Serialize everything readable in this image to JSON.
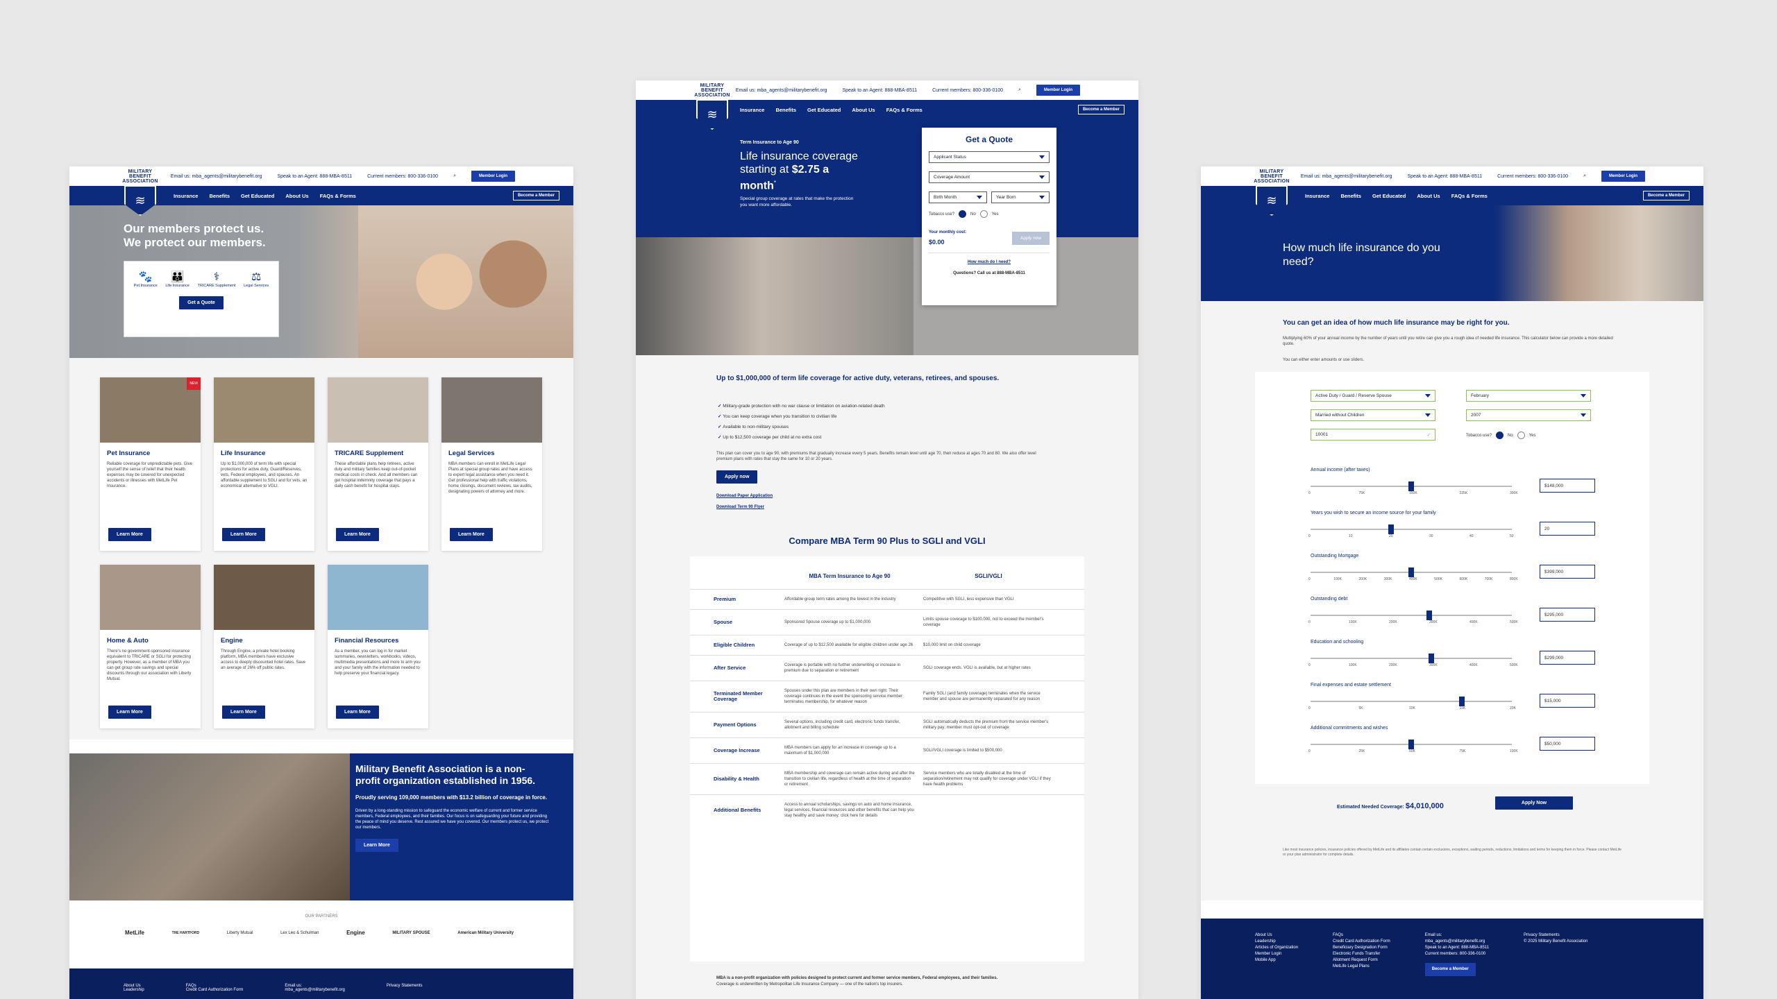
{
  "header": {
    "logo_text": [
      "MILITARY",
      "BENEFIT",
      "ASSOCIATION"
    ],
    "email": "Email us: mba_agents@militarybenefit.org",
    "agent": "Speak to an Agent: 888-MBA-8511",
    "members": "Current members: 800-336-0100",
    "login": "Member Login",
    "nav": [
      "Insurance",
      "Benefits",
      "Get Educated",
      "About Us",
      "FAQs & Forms"
    ],
    "become": "Become a Member"
  },
  "home": {
    "hero_title_1": "Our members protect us.",
    "hero_title_2": "We protect our members.",
    "quote_icons": [
      "Pet Insurance",
      "Life Insurance",
      "TRICARE Supplement",
      "Legal Services"
    ],
    "quote_btn": "Get a Quote",
    "cards": [
      {
        "title": "Pet Insurance",
        "text": "Reliable coverage for unpredictable pets. Give yourself the sense of relief that their health expenses may be covered for unexpected accidents or illnesses with MetLife Pet Insurance.",
        "btn": "Learn More",
        "badge": "NEW"
      },
      {
        "title": "Life Insurance",
        "text": "Up to $1,000,000 of term life with special protections for active duty, Guard/Reserves, vets, Federal employees, and spouses. An affordable supplement to SGLI and for vets, an economical alternative to VGLI.",
        "btn": "Learn More"
      },
      {
        "title": "TRICARE Supplement",
        "text": "These affordable plans help retirees, active duty and military families keep out-of-pocket medical costs in check. And all members can get hospital indemnity coverage that pays a daily cash benefit for hospital stays.",
        "btn": "Learn More"
      },
      {
        "title": "Legal Services",
        "text": "MBA members can enroll in MetLife Legal Plans at special group rates and have access to expert legal assistance when you need it. Get professional help with traffic violations, home closings, document reviews, tax audits, designating powers of attorney and more.",
        "btn": "Learn More"
      },
      {
        "title": "Home & Auto",
        "text": "There's no government-sponsored insurance equivalent to TRICARE or SGLI for protecting property. However, as a member of MBA you can get group rate savings and special discounts through our association with Liberty Mutual.",
        "btn": "Learn More"
      },
      {
        "title": "Engine",
        "text": "Through Engine, a private hotel booking platform, MBA members have exclusive access to deeply discounted hotel rates. Save an average of 26% off public rates.",
        "btn": "Learn More"
      },
      {
        "title": "Financial Resources",
        "text": "As a member, you can log in for market summaries, newsletters, workbooks, videos, multimedia presentations and more to arm you and your family with the information needed to help preserve your financial legacy.",
        "btn": "Learn More"
      }
    ],
    "banner_title": "Military Benefit Association is a non-profit organization established in 1956.",
    "banner_sub": "Proudly serving 109,000 members with $13.2 billion of coverage in force.",
    "banner_text": "Driven by a long-standing mission to safeguard the economic welfare of current and former service members, Federal employees, and their families. Our focus is on safeguarding your future and providing the peace of mind you deserve. Rest assured we have you covered. Our members protect us, we protect our members.",
    "banner_btn": "Learn More",
    "partners_title": "OUR PARTNERS",
    "partners": [
      "MetLife",
      "THE HARTFORD",
      "Liberty Mutual",
      "Lex Leo & Schulman",
      "Engine",
      "MILITARY SPOUSE",
      "American Military University"
    ],
    "footer": {
      "col1": [
        "About Us",
        "Leadership"
      ],
      "col2": [
        "FAQs",
        "Credit Card Authorization Form"
      ],
      "col3": [
        "Email us:",
        "mba_agents@militarybenefit.org"
      ],
      "col4": [
        "Privacy Statements"
      ]
    }
  },
  "life": {
    "eyebrow": "Term Insurance to Age 90",
    "hero_title": "Life insurance coverage starting at",
    "hero_price": "$2.75 a month",
    "hero_sup": "*",
    "hero_sub": "Special group coverage at rates that make the protection you want more affordable.",
    "quote_title": "Get a Quote",
    "fields": [
      "Applicant Status",
      "Coverage Amount",
      "Birth Month",
      "Year Born"
    ],
    "tobacco": "Tobacco use?",
    "no": "No",
    "yes": "Yes",
    "monthly": "Your monthly cost:",
    "cost": "$0.00",
    "apply": "Apply now",
    "how_much": "How much do I need?",
    "questions": "Questions? Call us at 888-MBA-8511",
    "headline": "Up to $1,000,000 of term life coverage for active duty, veterans, retirees, and spouses.",
    "bullets": [
      "Military-grade protection with no war clause or limitation on aviation-related death",
      "You can keep coverage when you transition to civilian life",
      "Available to non-military spouses",
      "Available to non-military spouses",
      "Up to $12,500 coverage per child at no extra cost"
    ],
    "para": "This plan can cover you to age 90, with premiums that gradually increase every 5 years. Benefits remain level until age 70, then reduce at ages 70 and 80. We also offer level premium plans with rates that stay the same for 10 or 20 years.",
    "apply_btn": "Apply now",
    "download1": "Download Paper Application",
    "download2": "Download Term 90 Flyer",
    "compare_title": "Compare MBA Term 90 Plus to SGLI and VGLI",
    "col_a": "MBA Term Insurance to Age 90",
    "col_b": "SGLI/VGLI",
    "rows": [
      [
        "Premium",
        "Affordable group term rates among the lowest in the industry",
        "Competitive with SGLI, less expensive than VGLI"
      ],
      [
        "Spouse",
        "Sponsored Spouse coverage up to $1,000,000",
        "Limits spouse coverage to $100,000, not to exceed the member's coverage"
      ],
      [
        "Eligible Children",
        "Coverage of up to $12,500 available for eligible children under age 26",
        "$10,000 limit on child coverage"
      ],
      [
        "After Service",
        "Coverage is portable with no further underwriting or increase in premium due to separation or retirement",
        "SGLI coverage ends. VGLI is available, but at higher rates"
      ],
      [
        "Terminated Member Coverage",
        "Spouses under this plan are members in their own right. Their coverage continues in the event the sponsoring service member terminates membership, for whatever reason",
        "Family SGLI (and family coverage) terminates when the service member and spouse are permanently separated for any reason"
      ],
      [
        "Payment Options",
        "Several options, including credit card, electronic funds transfer, allotment and billing schedule",
        "SGLI automatically deducts the premium from the service member's military pay; member must opt-out of coverage"
      ],
      [
        "Coverage Increase",
        "MBA members can apply for an increase in coverage up to a maximum of $1,000,000",
        "SGLI/VGLI coverage is limited to $500,000"
      ],
      [
        "Disability & Health",
        "MBA membership and coverage can remain active during and after the transition to civilian life, regardless of health at the time of separation or retirement",
        "Service members who are totally disabled at the time of separation/retirement may not qualify for coverage under VGLI if they have health problems"
      ],
      [
        "Additional Benefits",
        "Access to annual scholarships, savings on auto and home insurance, legal services, financial resources and other benefits that can help you stay healthy and save money: click here for details",
        ""
      ]
    ],
    "footnote": "MBA is a non-profit organization with policies designed to protect current and former service members, Federal employees, and their families.",
    "footnote2": "Coverage is underwritten by Metropolitan Life Insurance Company — one of the nation's top insurers."
  },
  "calc": {
    "hero_title": "How much life insurance do you need?",
    "intro_title": "You can get an idea of how much life insurance may be right for you.",
    "intro_text": "Multiplying 60% of your annual income by the number of years until you retire can give you a rough idea of needed life insurance. This calculator below can provide a more detailed quote.",
    "intro_text2": "You can either enter amounts or use sliders.",
    "sel": [
      "Active Duty / Guard / Reserve Spouse",
      "February",
      "Married without Children",
      "2007"
    ],
    "zip": "10001",
    "tobacco": "Tobacco use?",
    "no": "No",
    "yes": "Yes",
    "sliders": [
      {
        "label": "Annual income (after taxes)",
        "value": "$148,000",
        "ticks": [
          "0",
          "75K",
          "150K",
          "225K",
          "300K"
        ],
        "pos": 0.5
      },
      {
        "label": "Years you wish to secure an income source for your family",
        "value": "20",
        "ticks": [
          "0",
          "10",
          "20",
          "30",
          "40",
          "50"
        ],
        "pos": 0.4
      },
      {
        "label": "Outstanding Mortgage",
        "value": "$399,000",
        "ticks": [
          "0",
          "100K",
          "200K",
          "300K",
          "400K",
          "500K",
          "600K",
          "700K",
          "800K"
        ],
        "pos": 0.5
      },
      {
        "label": "Outstanding debt",
        "value": "$295,000",
        "ticks": [
          "0",
          "100K",
          "200K",
          "300K",
          "400K",
          "500K"
        ],
        "pos": 0.59
      },
      {
        "label": "Education and schooling",
        "value": "$299,000",
        "ticks": [
          "0",
          "100K",
          "200K",
          "300K",
          "400K",
          "500K"
        ],
        "pos": 0.6
      },
      {
        "label": "Final expenses and estate settlement",
        "value": "$15,000",
        "ticks": [
          "0",
          "5K",
          "10K",
          "15K",
          "20K"
        ],
        "pos": 0.75
      },
      {
        "label": "Additional commitments and wishes",
        "value": "$50,000",
        "ticks": [
          "0",
          "25K",
          "50K",
          "75K",
          "100K"
        ],
        "pos": 0.5
      }
    ],
    "estimate_label": "Estimated Needed Coverage:",
    "estimate": "$4,010,000",
    "apply": "Apply Now",
    "disclaimer": "Like most insurance policies, insurance policies offered by MetLife and its affiliates contain certain exclusions, exceptions, waiting periods, reductions, limitations and terms for keeping them in force. Please contact MetLife or your plan administrator for complete details.",
    "footer": {
      "col1": [
        "About Us",
        "Leadership",
        "Articles of Organization",
        "Member Login",
        "Mobile App"
      ],
      "col2": [
        "FAQs",
        "Credit Card Authorization Form",
        "Beneficiary Designation Form",
        "Electronic Funds Transfer",
        "Allotment Request Form",
        "MetLife Legal Plans"
      ],
      "col3": [
        "Email us:",
        "mba_agents@militarybenefit.org",
        "Speak to an Agent: 888-MBA-8511",
        "Current members: 800-336-0100"
      ],
      "col4": [
        "Privacy Statements",
        "© 2025 Military Benefit Association"
      ],
      "btn": "Become a Member"
    }
  }
}
